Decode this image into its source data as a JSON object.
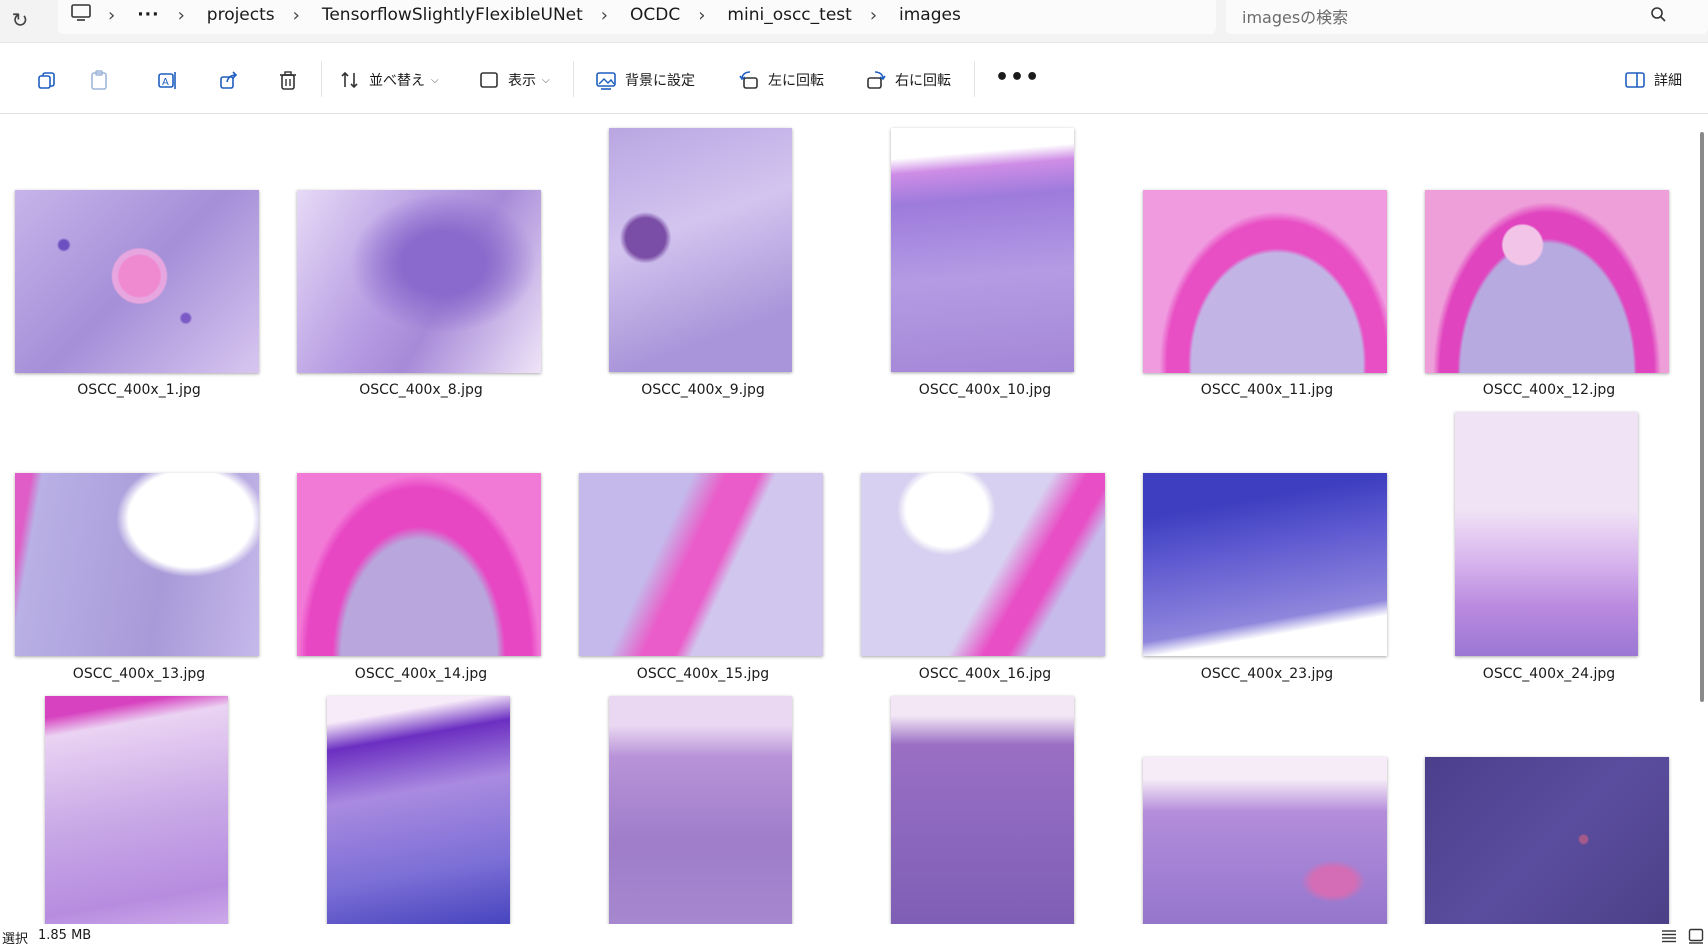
{
  "breadcrumb": {
    "overflow": "···",
    "items": [
      "projects",
      "TensorflowSlightlyFlexibleUNet",
      "OCDC",
      "mini_oscc_test",
      "images"
    ]
  },
  "search": {
    "placeholder": "imagesの検索"
  },
  "toolbar": {
    "sort_label": "並べ替え",
    "view_label": "表示",
    "set_background_label": "背景に設定",
    "rotate_left_label": "左に回転",
    "rotate_right_label": "右に回転",
    "more_label": "•••",
    "details_label": "詳細"
  },
  "files": [
    {
      "name": "OSCC_400x_1.jpg"
    },
    {
      "name": "OSCC_400x_8.jpg"
    },
    {
      "name": "OSCC_400x_9.jpg"
    },
    {
      "name": "OSCC_400x_10.jpg"
    },
    {
      "name": "OSCC_400x_11.jpg"
    },
    {
      "name": "OSCC_400x_12.jpg"
    },
    {
      "name": "OSCC_400x_13.jpg"
    },
    {
      "name": "OSCC_400x_14.jpg"
    },
    {
      "name": "OSCC_400x_15.jpg"
    },
    {
      "name": "OSCC_400x_16.jpg"
    },
    {
      "name": "OSCC_400x_23.jpg"
    },
    {
      "name": "OSCC_400x_24.jpg"
    },
    {
      "name": ""
    },
    {
      "name": ""
    },
    {
      "name": ""
    },
    {
      "name": ""
    },
    {
      "name": ""
    },
    {
      "name": ""
    }
  ],
  "status": {
    "selected_label": "選択",
    "size": "1.85 MB"
  }
}
